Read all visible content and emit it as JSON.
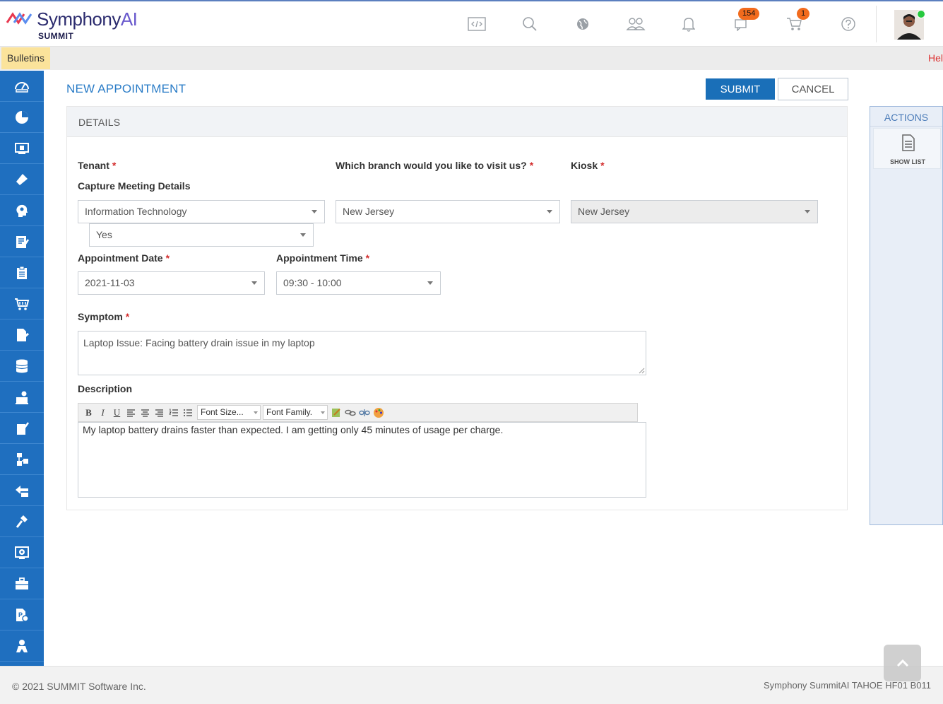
{
  "header": {
    "brand_name": "Symphony",
    "brand_ai": "AI",
    "brand_sub": "SUMMIT",
    "messages_count": "154",
    "cart_count": "1",
    "icons": [
      "code-icon",
      "search-icon",
      "globe-icon",
      "users-icon",
      "bell-icon",
      "chat-icon",
      "cart-icon",
      "help-icon"
    ]
  },
  "bulletin": {
    "tab_label": "Bulletins",
    "marquee_text": "Hel"
  },
  "sidebar": {
    "icons": [
      "dashboard-icon",
      "pie-chart-icon",
      "monitor-icon",
      "ticket-icon",
      "head-gear-icon",
      "edit-note-icon",
      "clipboard-icon",
      "shopping-cart-icon",
      "document-edit-icon",
      "database-icon",
      "person-laptop-icon",
      "mobile-edit-icon",
      "hierarchy-icon",
      "layers-icon",
      "hammer-icon",
      "monitor-gear-icon",
      "briefcase-icon",
      "document-gear-icon",
      "person-icon"
    ]
  },
  "page": {
    "title": "NEW APPOINTMENT",
    "submit_label": "SUBMIT",
    "cancel_label": "CANCEL"
  },
  "details": {
    "section_title": "DETAILS",
    "tenant": {
      "label": "Tenant",
      "required": "*",
      "value": "Information Technology"
    },
    "branch": {
      "label": "Which branch would you like to visit us?",
      "required": "*",
      "value": "New Jersey"
    },
    "kiosk": {
      "label": "Kiosk",
      "required": "*",
      "value": "New Jersey"
    },
    "capture_meeting": {
      "label": "Capture Meeting Details",
      "value": "Yes"
    },
    "appointment_date": {
      "label": "Appointment Date",
      "required": "*",
      "value": "2021-11-03"
    },
    "appointment_time": {
      "label": "Appointment Time",
      "required": "*",
      "value": "09:30 - 10:00"
    },
    "symptom": {
      "label": "Symptom",
      "required": "*",
      "value": "Laptop Issue: Facing battery drain issue in my laptop"
    },
    "description": {
      "label": "Description",
      "font_size_placeholder": "Font Size...",
      "font_family_placeholder": "Font Family.",
      "value": "My laptop battery drains faster than expected. I am getting only 45 minutes of usage per charge."
    }
  },
  "actions": {
    "title": "ACTIONS",
    "show_list_label": "SHOW LIST"
  },
  "footer": {
    "copyright": "© 2021 SUMMIT Software Inc.",
    "version": "Symphony SummitAI TAHOE HF01 B011"
  }
}
